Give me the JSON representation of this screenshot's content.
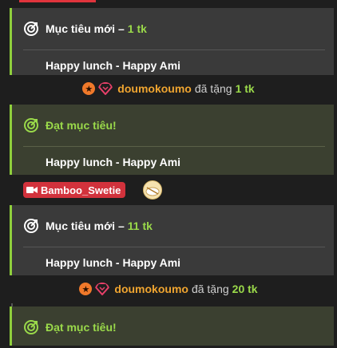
{
  "cards": [
    {
      "title": "Mục tiêu mới",
      "sep": "–",
      "amount": "1 tk",
      "body": "Happy lunch - Happy Ami"
    },
    {
      "title": "Đạt mục tiêu!",
      "body": "Happy lunch - Happy Ami"
    },
    {
      "title": "Mục tiêu mới",
      "sep": "–",
      "amount": "11 tk",
      "body": "Happy lunch - Happy Ami"
    },
    {
      "title": "Đạt mục tiêu!"
    }
  ],
  "gifts": [
    {
      "user": "doumokoumo",
      "verb": "đã tặng",
      "amount": "1 tk"
    },
    {
      "user": "doumokoumo",
      "verb": "đã tặng",
      "amount": "20 tk"
    }
  ],
  "streamer": {
    "name": "Bamboo_Swetie",
    "avatar_icon": "rice-bowl-avatar"
  },
  "colors": {
    "goal_green": "#9ad94a",
    "achieved_bg": "#3b4030",
    "card_bg": "#3a3a3a",
    "username_orange": "#f0a530",
    "streamer_red": "#d2323c"
  }
}
